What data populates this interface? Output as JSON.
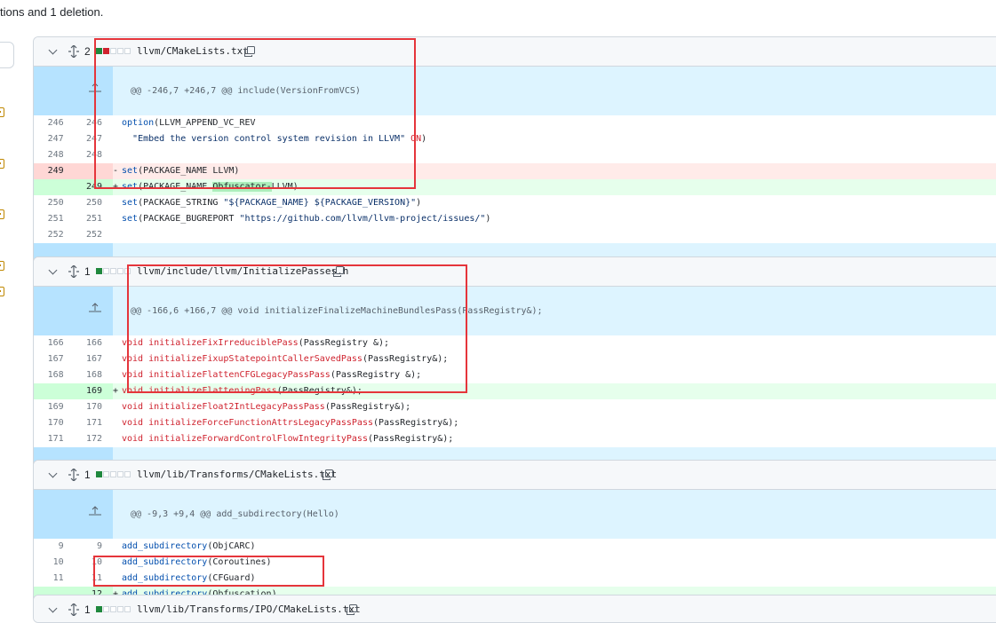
{
  "summary": "tions and 1 deletion.",
  "files": [
    {
      "change_count": "2",
      "blocks": [
        "add",
        "del",
        "neu",
        "neu",
        "neu"
      ],
      "path": "llvm/CMakeLists.txt",
      "hunk": "@@ -246,7 +246,7 @@ include(VersionFromVCS)",
      "lines": [
        {
          "type": "ctx",
          "old": "246",
          "new": "246",
          "marker": "",
          "code": "option(LLVM_APPEND_VC_REV"
        },
        {
          "type": "ctx",
          "old": "247",
          "new": "247",
          "marker": "",
          "code": "  \"Embed the version control system revision in LLVM\" ON)"
        },
        {
          "type": "ctx",
          "old": "248",
          "new": "248",
          "marker": "",
          "code": ""
        },
        {
          "type": "del",
          "old": "249",
          "new": "",
          "marker": "-",
          "code": "set(PACKAGE_NAME LLVM)"
        },
        {
          "type": "add",
          "old": "",
          "new": "249",
          "marker": "+",
          "code": "set(PACKAGE_NAME Obfuscator-LLVM)"
        },
        {
          "type": "ctx",
          "old": "250",
          "new": "250",
          "marker": "",
          "code": "set(PACKAGE_STRING \"${PACKAGE_NAME} ${PACKAGE_VERSION}\")"
        },
        {
          "type": "ctx",
          "old": "251",
          "new": "251",
          "marker": "",
          "code": "set(PACKAGE_BUGREPORT \"https://github.com/llvm/llvm-project/issues/\")"
        },
        {
          "type": "ctx",
          "old": "252",
          "new": "252",
          "marker": "",
          "code": ""
        }
      ]
    },
    {
      "change_count": "1",
      "blocks": [
        "add",
        "neu",
        "neu",
        "neu",
        "neu"
      ],
      "path": "llvm/include/llvm/InitializePasses.h",
      "hunk": "@@ -166,6 +166,7 @@ void initializeFinalizeMachineBundlesPass(PassRegistry&);",
      "lines": [
        {
          "type": "ctx",
          "old": "166",
          "new": "166",
          "marker": "",
          "code": "void initializeFixIrreduciblePass(PassRegistry &);"
        },
        {
          "type": "ctx",
          "old": "167",
          "new": "167",
          "marker": "",
          "code": "void initializeFixupStatepointCallerSavedPass(PassRegistry&);"
        },
        {
          "type": "ctx",
          "old": "168",
          "new": "168",
          "marker": "",
          "code": "void initializeFlattenCFGLegacyPassPass(PassRegistry &);"
        },
        {
          "type": "add",
          "old": "",
          "new": "169",
          "marker": "+",
          "code": "void initializeFlatteningPass(PassRegistry&);"
        },
        {
          "type": "ctx",
          "old": "169",
          "new": "170",
          "marker": "",
          "code": "void initializeFloat2IntLegacyPassPass(PassRegistry&);"
        },
        {
          "type": "ctx",
          "old": "170",
          "new": "171",
          "marker": "",
          "code": "void initializeForceFunctionAttrsLegacyPassPass(PassRegistry&);"
        },
        {
          "type": "ctx",
          "old": "171",
          "new": "172",
          "marker": "",
          "code": "void initializeForwardControlFlowIntegrityPass(PassRegistry&);"
        }
      ]
    },
    {
      "change_count": "1",
      "blocks": [
        "add",
        "neu",
        "neu",
        "neu",
        "neu"
      ],
      "path": "llvm/lib/Transforms/CMakeLists.txt",
      "hunk": "@@ -9,3 +9,4 @@ add_subdirectory(Hello)",
      "lines": [
        {
          "type": "ctx",
          "old": "9",
          "new": "9",
          "marker": "",
          "code": "add_subdirectory(ObjCARC)"
        },
        {
          "type": "ctx",
          "old": "10",
          "new": "10",
          "marker": "",
          "code": "add_subdirectory(Coroutines)"
        },
        {
          "type": "ctx",
          "old": "11",
          "new": "11",
          "marker": "",
          "code": "add_subdirectory(CFGuard)"
        },
        {
          "type": "add",
          "old": "",
          "new": "12",
          "marker": "+",
          "code": "add_subdirectory(Obfuscation)"
        }
      ]
    },
    {
      "change_count": "1",
      "blocks": [
        "add",
        "neu",
        "neu",
        "neu",
        "neu"
      ],
      "path": "llvm/lib/Transforms/IPO/CMakeLists.txt"
    }
  ]
}
